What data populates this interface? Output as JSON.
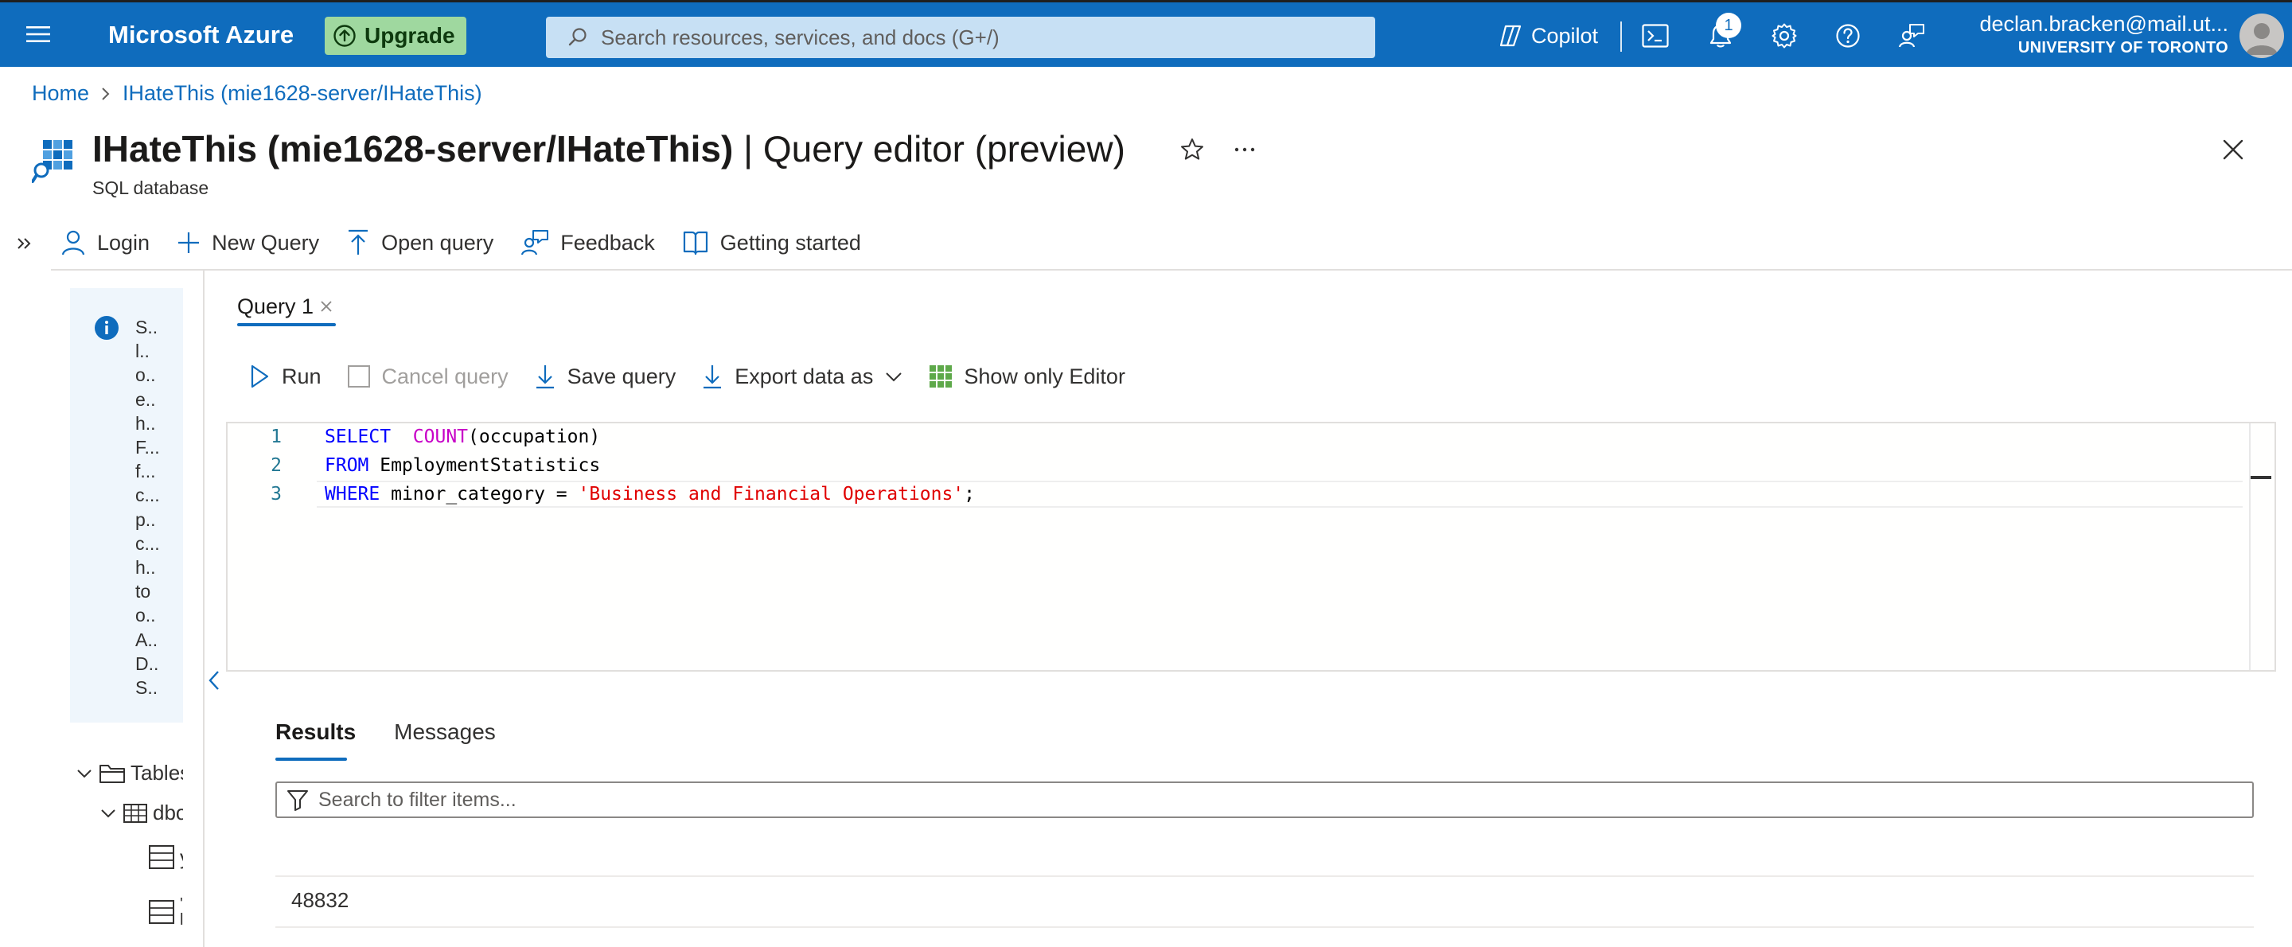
{
  "topbar": {
    "brand": "Microsoft Azure",
    "upgrade_label": "Upgrade",
    "search_placeholder": "Search resources, services, and docs (G+/)",
    "copilot_label": "Copilot",
    "notification_count": "1",
    "account_email": "declan.bracken@mail.ut...",
    "account_org": "UNIVERSITY OF TORONTO"
  },
  "breadcrumb": {
    "home": "Home",
    "current": "IHateThis (mie1628-server/IHateThis)"
  },
  "page": {
    "title_bold": "IHateThis (mie1628-server/IHateThis)",
    "title_rest": " | Query editor (preview)",
    "subtitle": "SQL database"
  },
  "commandbar": {
    "login": "Login",
    "new_query": "New Query",
    "open_query": "Open query",
    "feedback": "Feedback",
    "getting_started": "Getting started"
  },
  "info_panel": {
    "lines": [
      "S..",
      "l..",
      "o..",
      "e..",
      "h..",
      "F...",
      "f...",
      "c...",
      "p..",
      "c...",
      "h..",
      "to",
      "o..",
      "A..",
      "D..",
      "S.."
    ]
  },
  "explorer": {
    "tables_label": "Tables",
    "schema_label": "dbo",
    "table1_label": "y",
    "table2_label": "'",
    "table2_sub": "l"
  },
  "query_tab": {
    "label": "Query 1"
  },
  "editor_toolbar": {
    "run": "Run",
    "cancel": "Cancel query",
    "save": "Save query",
    "export": "Export data as",
    "show_only": "Show only Editor"
  },
  "editor": {
    "line_numbers": [
      "1",
      "2",
      "3"
    ],
    "line1": {
      "kw": "SELECT",
      "sp": "  ",
      "fn": "COUNT",
      "rest": "(occupation)"
    },
    "line2": {
      "kw": "FROM",
      "rest": " EmploymentStatistics"
    },
    "line3": {
      "kw": "WHERE",
      "mid": " minor_category = ",
      "str": "'Business and Financial Operations'",
      "end": ";"
    }
  },
  "results": {
    "tab_results": "Results",
    "tab_messages": "Messages",
    "filter_placeholder": "Search to filter items...",
    "rows": [
      [
        "48832"
      ]
    ]
  },
  "colors": {
    "accent": "#0f6cbd",
    "upgrade_bg": "#9fd89f",
    "search_bg": "#c7e0f4",
    "info_bg": "#eff6fc",
    "keyword": "#0000ff",
    "function": "#c700c7",
    "string": "#e00000"
  }
}
